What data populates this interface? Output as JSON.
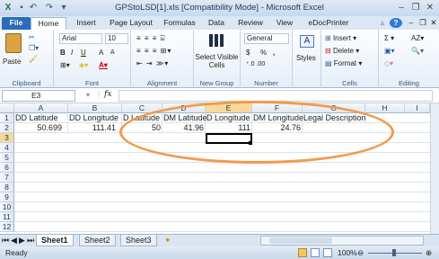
{
  "window": {
    "title": "GPStoLSD[1].xls  [Compatibility Mode] - Microsoft Excel"
  },
  "ribbon_tabs": [
    "File",
    "Home",
    "Insert",
    "Page Layout",
    "Formulas",
    "Data",
    "Review",
    "View",
    "eDocPrinter"
  ],
  "ribbon": {
    "clipboard": {
      "label": "Clipboard",
      "paste": "Paste"
    },
    "font": {
      "label": "Font",
      "name": "Arial",
      "size": "10",
      "bold": "B",
      "italic": "I",
      "underline": "U",
      "grow": "A",
      "shrink": "A"
    },
    "alignment": {
      "label": "Alignment"
    },
    "styles_group": {
      "label": "New Group",
      "select_visible": "Select Visible Cells"
    },
    "number": {
      "label": "Number",
      "format": "General",
      "currency": "$",
      "percent": "%",
      "comma": ","
    },
    "styles": {
      "label": "Styles"
    },
    "cells": {
      "label": "Cells",
      "insert": "Insert",
      "delete": "Delete",
      "format": "Format"
    },
    "editing": {
      "label": "Editing",
      "sum": "Σ",
      "sort": "AZ"
    }
  },
  "formula_bar": {
    "name_box": "E3",
    "fx": "fx",
    "value": ""
  },
  "columns": [
    "A",
    "B",
    "C",
    "D",
    "E",
    "F",
    "G",
    "H",
    "I"
  ],
  "rows": [
    "1",
    "2",
    "3",
    "4",
    "5",
    "6",
    "7",
    "8",
    "9",
    "10",
    "11",
    "12"
  ],
  "cells": {
    "row1": [
      "DD Latitude",
      "DD Longitude",
      "D Latitude",
      "DM Latitude",
      "D Longitude",
      "DM Longitude",
      "Legal Description"
    ],
    "row2": [
      "50.699",
      "111.41",
      "50",
      "41.96",
      "111",
      "24.76"
    ]
  },
  "sheets": [
    "Sheet1",
    "Sheet2",
    "Sheet3"
  ],
  "status": {
    "ready": "Ready",
    "zoom": "100%"
  }
}
